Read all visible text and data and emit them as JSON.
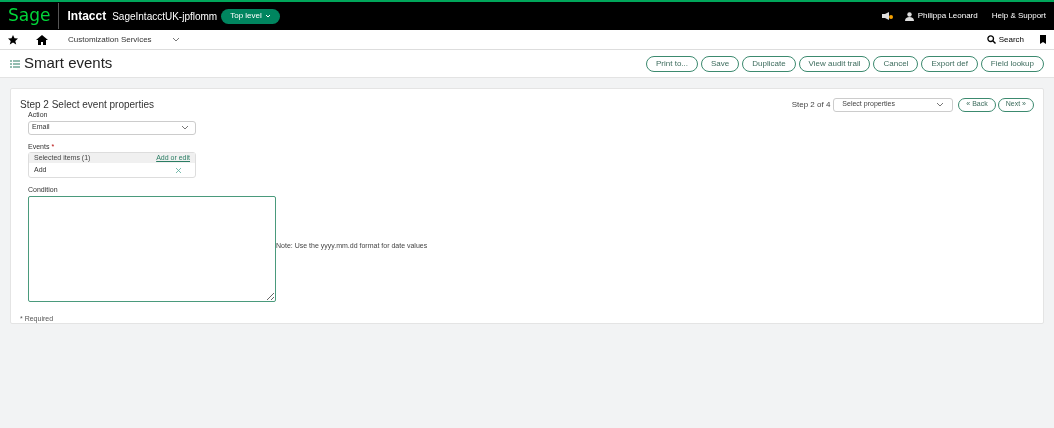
{
  "topbar": {
    "logo": "Sage",
    "product": "Intacct",
    "company": "SageIntacctUK-jpflomm",
    "level_button": "Top level",
    "user": "Philippa Leonard",
    "help": "Help & Support"
  },
  "nav": {
    "menu": "Customization Services",
    "search": "Search"
  },
  "page": {
    "title": "Smart events",
    "buttons": [
      "Print to...",
      "Save",
      "Duplicate",
      "View audit trail",
      "Cancel",
      "Export def",
      "Field lookup"
    ]
  },
  "form": {
    "heading": "Step 2 Select event properties",
    "step_label": "Step 2 of 4",
    "step_select": "Select properties",
    "back": "« Back",
    "next": "Next »",
    "action": {
      "label": "Action",
      "value": "Email"
    },
    "events": {
      "label": "Events",
      "required_mark": "*",
      "selected": "Selected items (1)",
      "add_edit": "Add or edit",
      "items": [
        "Add"
      ]
    },
    "condition": {
      "label": "Condition",
      "note": "Note: Use the yyyy.mm.dd format for date values"
    },
    "required_note": "* Required"
  }
}
